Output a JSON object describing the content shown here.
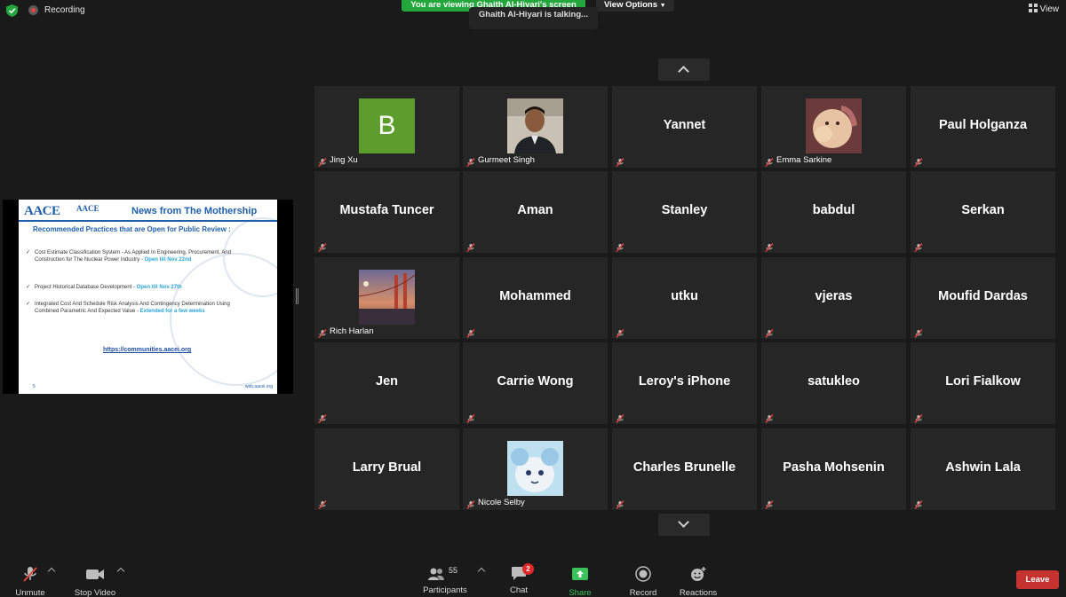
{
  "topbar": {
    "recording_label": "Recording",
    "viewing_banner": "You are viewing Ghaith Al-Hiyari's screen",
    "view_options": "View Options",
    "talking": "Ghaith Al-Hiyari is talking...",
    "view_label": "View"
  },
  "slide": {
    "logo": "AACE",
    "logo_small": "AACE",
    "title": "News from The Mothership",
    "subtitle": "Recommended Practices that are Open for Public Review :",
    "items": [
      {
        "text": "Cost Estimate Classification System - As Applied In Engineering, Procurement, And Construction for The Nuclear Power Industry - ",
        "highlight": "Open till Nov 22nd"
      },
      {
        "text": "Project Historical Database Development - ",
        "highlight": "Open till Nov 27th"
      },
      {
        "text": "Integrated Cost And Schedule Risk Analysis And Contingency Determination Using Combined Parametric And Expected Value - ",
        "highlight": "Extended for a few weeks"
      }
    ],
    "link": "https://communities.aacei.org",
    "page_number": "5",
    "website": "web.aacei.org"
  },
  "participants": [
    {
      "name": "Jing Xu",
      "kind": "letter",
      "letter": "B"
    },
    {
      "name": "Gurmeet Singh",
      "kind": "photo",
      "photo": "man-suit"
    },
    {
      "name": "Yannet",
      "kind": "text"
    },
    {
      "name": "Emma Sarkine",
      "kind": "photo",
      "photo": "baby"
    },
    {
      "name": "Paul Holganza",
      "kind": "text"
    },
    {
      "name": "Mustafa Tuncer",
      "kind": "text"
    },
    {
      "name": "Aman",
      "kind": "text"
    },
    {
      "name": "Stanley",
      "kind": "text"
    },
    {
      "name": "babdul",
      "kind": "text"
    },
    {
      "name": "Serkan",
      "kind": "text"
    },
    {
      "name": "Rich Harlan",
      "kind": "photo",
      "photo": "bridge"
    },
    {
      "name": "Mohammed",
      "kind": "text"
    },
    {
      "name": "utku",
      "kind": "text"
    },
    {
      "name": "vjeras",
      "kind": "text"
    },
    {
      "name": "Moufid Dardas",
      "kind": "text"
    },
    {
      "name": "Jen",
      "kind": "text"
    },
    {
      "name": "Carrie Wong",
      "kind": "text"
    },
    {
      "name": "Leroy's iPhone",
      "kind": "text"
    },
    {
      "name": "satukleo",
      "kind": "text"
    },
    {
      "name": "Lori Fialkow",
      "kind": "text"
    },
    {
      "name": "Larry Brual",
      "kind": "text"
    },
    {
      "name": "Nicole Selby",
      "kind": "photo",
      "photo": "cartoon"
    },
    {
      "name": "Charles Brunelle",
      "kind": "text"
    },
    {
      "name": "Pasha Mohsenin",
      "kind": "text"
    },
    {
      "name": "Ashwin Lala",
      "kind": "text"
    }
  ],
  "toolbar": {
    "unmute": "Unmute",
    "stop_video": "Stop Video",
    "participants": "Participants",
    "participant_count": "55",
    "chat": "Chat",
    "chat_badge": "2",
    "share_screen": "Share Screen",
    "record": "Record",
    "reactions": "Reactions",
    "leave": "Leave"
  },
  "colors": {
    "banner_green": "#23a63b",
    "leave_red": "#c63230",
    "tile_bg": "#262626",
    "slide_blue": "#1f5eab"
  }
}
